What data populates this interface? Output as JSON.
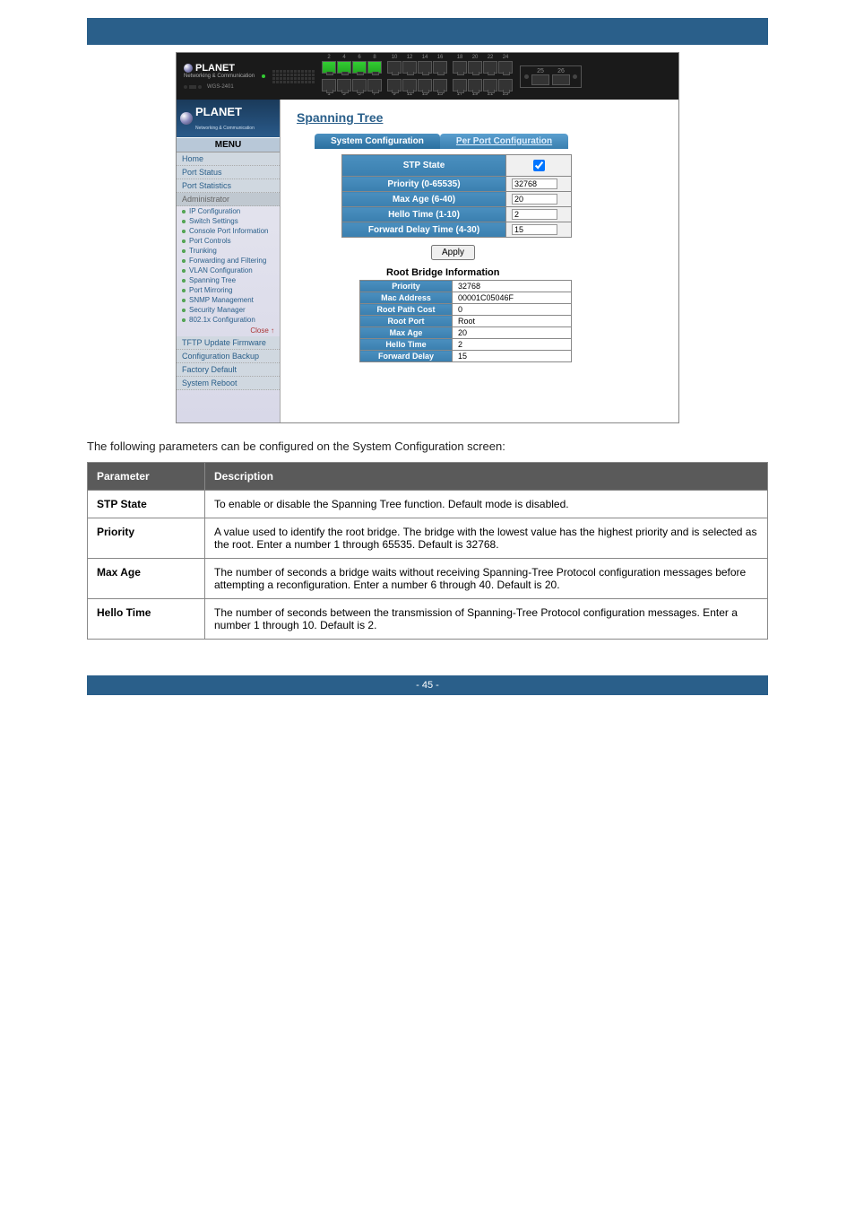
{
  "doc": {
    "footer_page": "- 45 -",
    "caption_text": " ",
    "desc_text": "The following parameters can be configured on the System Configuration screen:"
  },
  "logo": {
    "brand": "PLANET",
    "sub": "Networking & Communication"
  },
  "device": {
    "model_left": "WGS-2401",
    "port_numbers_top": [
      "2",
      "4",
      "6",
      "8",
      "10",
      "12",
      "14",
      "16",
      "18",
      "20",
      "22",
      "24"
    ],
    "port_numbers_bot": [
      "1",
      "3",
      "5",
      "7",
      "9",
      "11",
      "13",
      "15",
      "17",
      "19",
      "21",
      "23"
    ],
    "uplink_labels": [
      "25",
      "26"
    ]
  },
  "menu": {
    "header": "MENU",
    "items": [
      "Home",
      "Port Status",
      "Port Statistics",
      "Administrator"
    ],
    "sub": [
      "IP Configuration",
      "Switch Settings",
      "Console Port Information",
      "Port Controls",
      "Trunking",
      "Forwarding and Filtering",
      "VLAN Configuration",
      "Spanning Tree",
      "Port Mirroring",
      "SNMP Management",
      "Security Manager",
      "802.1x Configuration"
    ],
    "close": "Close ↑",
    "items2": [
      "TFTP Update Firmware",
      "Configuration Backup",
      "Factory Default",
      "System Reboot"
    ]
  },
  "content": {
    "title": "Spanning Tree",
    "tab1": "System Configuration",
    "tab2": "Per Port Configuration",
    "rows": [
      {
        "label": "STP State",
        "type": "check"
      },
      {
        "label": "Priority (0-65535)",
        "value": "32768"
      },
      {
        "label": "Max Age (6-40)",
        "value": "20"
      },
      {
        "label": "Hello Time (1-10)",
        "value": "2"
      },
      {
        "label": "Forward Delay Time (4-30)",
        "value": "15"
      }
    ],
    "apply": "Apply",
    "rbi_title": "Root Bridge Information",
    "rbi": [
      {
        "label": "Priority",
        "value": "32768"
      },
      {
        "label": "Mac Address",
        "value": "00001C05046F"
      },
      {
        "label": "Root Path Cost",
        "value": "0"
      },
      {
        "label": "Root Port",
        "value": "Root"
      },
      {
        "label": "Max Age",
        "value": "20"
      },
      {
        "label": "Hello Time",
        "value": "2"
      },
      {
        "label": "Forward Delay",
        "value": "15"
      }
    ]
  },
  "params": {
    "header_param": "Parameter",
    "header_desc": "Description",
    "rows": [
      {
        "name": "STP State",
        "desc": "To enable or disable the Spanning Tree function. Default mode is disabled."
      },
      {
        "name": "Priority",
        "desc": "A value used to identify the root bridge. The bridge with the lowest value has the highest priority and is selected as the root. Enter a number 1 through 65535. Default is 32768."
      },
      {
        "name": "Max Age",
        "desc": "The number of seconds a bridge waits without receiving Spanning-Tree Protocol configuration messages before attempting a reconfiguration. Enter a number 6 through 40. Default is 20."
      },
      {
        "name": "Hello Time",
        "desc": "The number of seconds between the transmission of Spanning-Tree Protocol configuration messages. Enter a number 1 through 10. Default is 2."
      }
    ]
  }
}
